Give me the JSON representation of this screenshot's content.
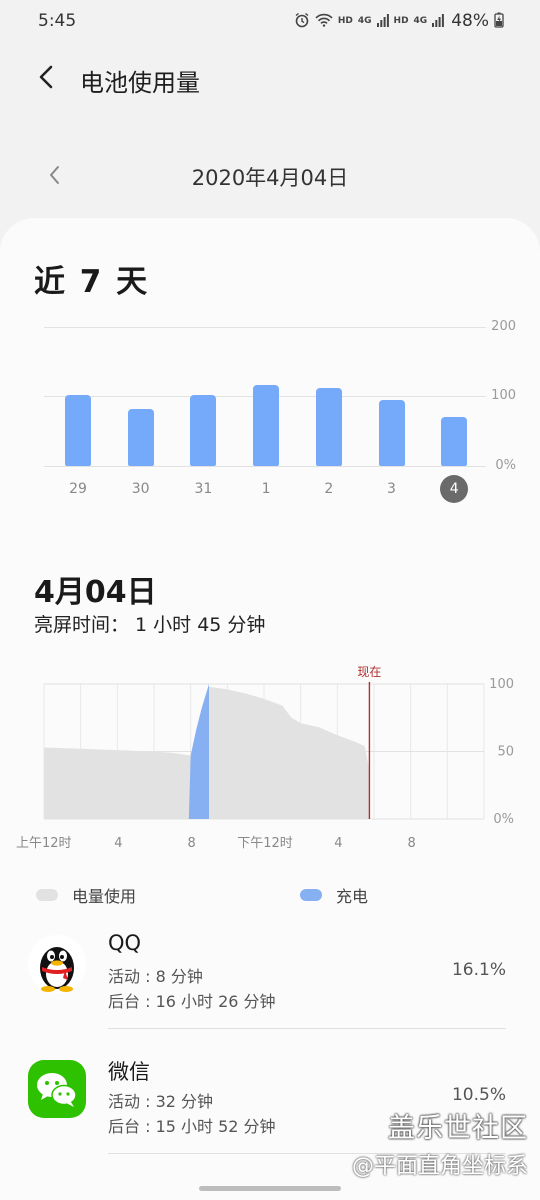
{
  "status_bar": {
    "time": "5:45",
    "hd_label_1": "HD",
    "net_label_1": "4G",
    "hd_label_2": "HD",
    "net_label_2": "4G",
    "battery_text": "48%",
    "icons": [
      "alarm-icon",
      "wifi-icon",
      "signal-icon",
      "signal-icon",
      "battery-charging-icon"
    ]
  },
  "header": {
    "back_icon": "chevron-left-icon",
    "title": "电池使用量"
  },
  "date_nav": {
    "prev_icon": "chevron-left-icon",
    "date": "2020年4月04日"
  },
  "week": {
    "title": "近 7 天",
    "y_ticks": [
      "200",
      "100",
      "0%"
    ],
    "selected_label": "4"
  },
  "chart_data": [
    {
      "type": "bar",
      "categories": [
        "29",
        "30",
        "31",
        "1",
        "2",
        "3",
        "4"
      ],
      "values": [
        102,
        82,
        102,
        117,
        112,
        95,
        70
      ],
      "ylim": [
        0,
        200
      ],
      "y_ticks": [
        "0%",
        "100",
        "200"
      ],
      "grid": true,
      "color": "#75a9f9",
      "selected_category": "4"
    },
    {
      "type": "area",
      "x_tick_labels": [
        "上午12时",
        "4",
        "8",
        "下午12时",
        "4",
        "8"
      ],
      "y_ticks": [
        "0%",
        "50",
        "100"
      ],
      "ylim": [
        0,
        100
      ],
      "xlim": [
        0,
        24
      ],
      "now_label": "现在",
      "now_hour": 17.75,
      "series": [
        {
          "name": "电量使用",
          "color": "#e2e2e2",
          "x": [
            0,
            1,
            2,
            3,
            4,
            5,
            6,
            7,
            8,
            8.25,
            9,
            10,
            11,
            12,
            13,
            13.5,
            14,
            15,
            16,
            17,
            17.5,
            17.75
          ],
          "y": [
            53,
            52.5,
            52,
            51.5,
            51,
            50.5,
            50,
            49,
            47,
            47,
            98,
            96,
            93,
            89,
            84,
            75,
            71,
            68,
            62,
            57,
            54,
            36
          ]
        },
        {
          "name": "充电",
          "color": "#86b0f2",
          "x": [
            7.9,
            8.0,
            8.3,
            8.6,
            9.0
          ],
          "y": [
            0,
            47,
            66,
            82,
            100
          ]
        }
      ]
    }
  ],
  "day": {
    "title": "4月04日",
    "screen_time": "亮屏时间：  1 小时 45 分钟"
  },
  "legend": {
    "usage_label": "电量使用",
    "usage_color": "#e2e2e2",
    "charging_label": "充电",
    "charging_color": "#86b0f2"
  },
  "apps": [
    {
      "name": "QQ",
      "icon": "qq-penguin-icon",
      "active": "活动 : 8 分钟",
      "background": "后台 : 16 小时 26 分钟",
      "percent": "16.1%"
    },
    {
      "name": "微信",
      "icon": "wechat-icon",
      "icon_color": "#2dc100",
      "active": "活动 : 32 分钟",
      "background": "后台 : 15 小时 52 分钟",
      "percent": "10.5%"
    }
  ],
  "watermark": {
    "line1": "盖乐世社区",
    "line2": "@平面直角坐标系"
  }
}
